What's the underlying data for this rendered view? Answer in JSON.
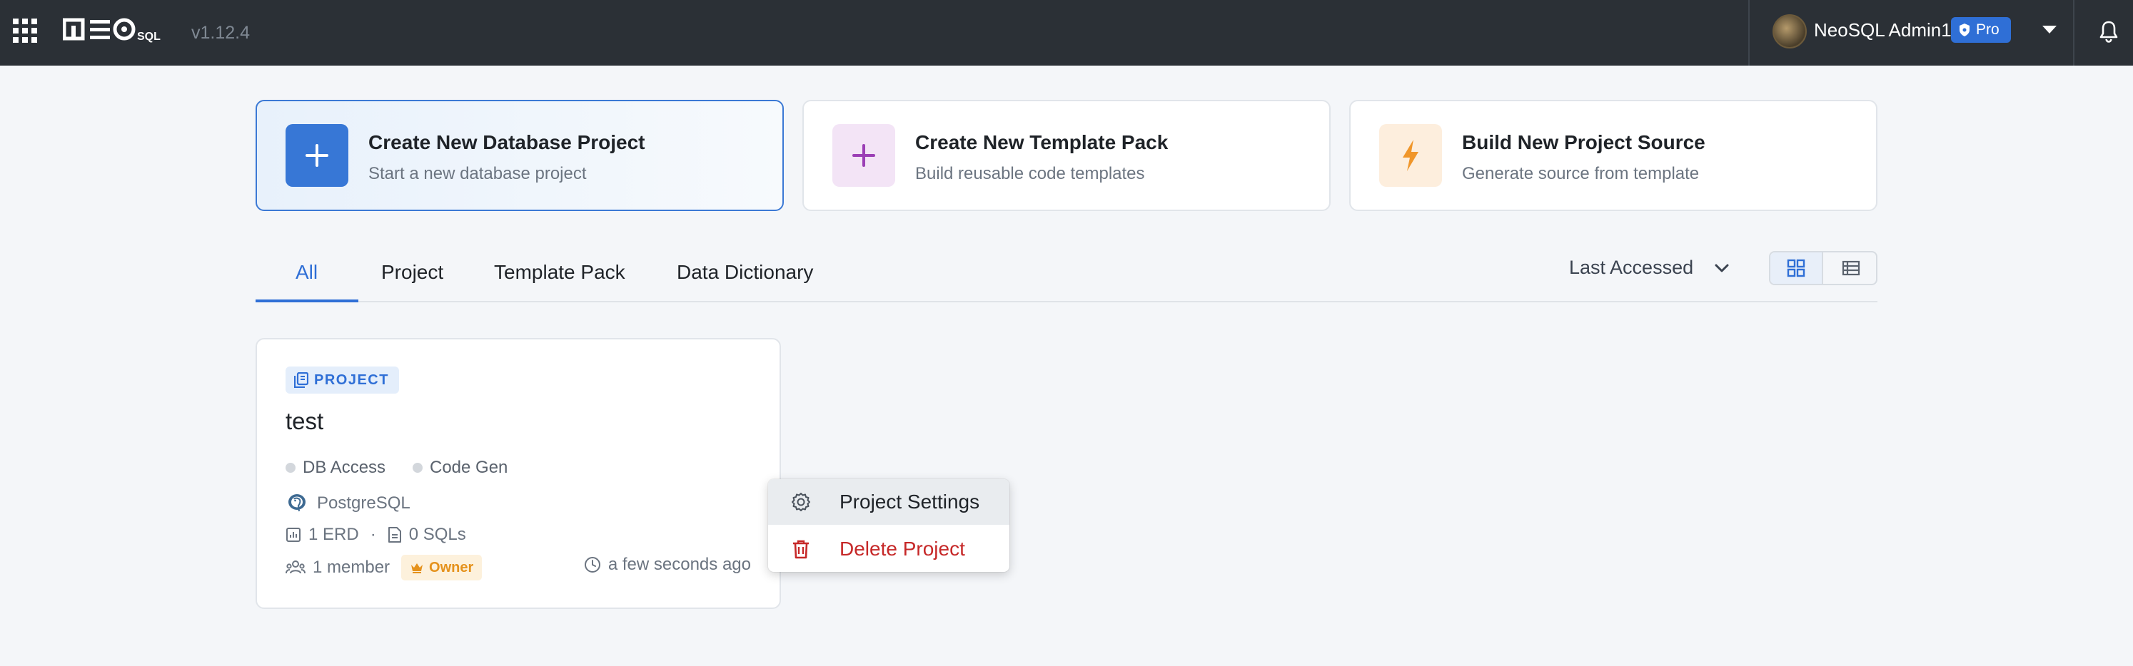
{
  "header": {
    "logo_text": "NEO SQL",
    "version": "v1.12.4",
    "user_name": "NeoSQL Admin1",
    "plan_badge": "Pro"
  },
  "actions": [
    {
      "title": "Create New Database Project",
      "subtitle": "Start a new database project",
      "icon": "plus-icon",
      "accent": "#3777d6"
    },
    {
      "title": "Create New Template Pack",
      "subtitle": "Build reusable code templates",
      "icon": "plus-icon",
      "accent": "#9b3fb5"
    },
    {
      "title": "Build New Project Source",
      "subtitle": "Generate source from template",
      "icon": "lightning-icon",
      "accent": "#f0962a"
    }
  ],
  "tabs": [
    {
      "label": "All",
      "active": true
    },
    {
      "label": "Project",
      "active": false
    },
    {
      "label": "Template Pack",
      "active": false
    },
    {
      "label": "Data Dictionary",
      "active": false
    }
  ],
  "sort": {
    "label": "Last Accessed"
  },
  "view_mode": "grid",
  "project": {
    "type_tag": "PROJECT",
    "name": "test",
    "capabilities": [
      "DB Access",
      "Code Gen"
    ],
    "database": "PostgreSQL",
    "erd_count": "1 ERD",
    "sql_count": "0 SQLs",
    "members": "1 member",
    "role": "Owner",
    "last_accessed": "a few seconds ago"
  },
  "context_menu": {
    "settings_label": "Project Settings",
    "delete_label": "Delete Project"
  },
  "colors": {
    "topbar": "#2b3036",
    "accent": "#2f6fd6",
    "danger": "#c62828",
    "owner": "#e5921c"
  }
}
